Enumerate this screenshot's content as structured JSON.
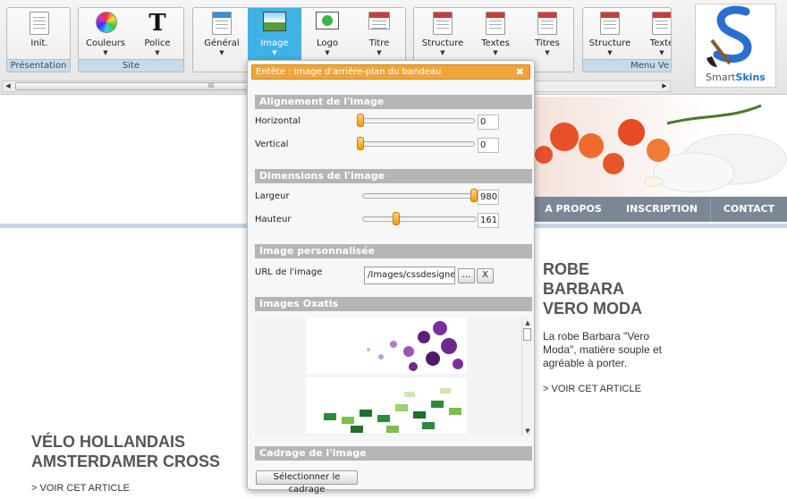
{
  "toolbar": {
    "groups": [
      {
        "title": "Présentation",
        "buttons": [
          {
            "label": "Init."
          }
        ]
      },
      {
        "title": "Site",
        "buttons": [
          {
            "label": "Couleurs"
          },
          {
            "label": "Police"
          }
        ]
      },
      {
        "title": "",
        "buttons": [
          {
            "label": "Général"
          },
          {
            "label": "Image"
          },
          {
            "label": "Logo"
          },
          {
            "label": "Titre"
          }
        ]
      },
      {
        "title": "",
        "buttons": [
          {
            "label": "Structure"
          },
          {
            "label": "Textes"
          },
          {
            "label": "Titres"
          }
        ]
      },
      {
        "title": "Menu Ve",
        "buttons": [
          {
            "label": "Structure"
          },
          {
            "label": "Texte"
          }
        ]
      }
    ],
    "scroll_thumb_grip": "III",
    "active_button": "Image"
  },
  "logo": {
    "word_plain": "Smart",
    "word_bold": "Skins"
  },
  "site": {
    "nav": [
      "A PROPOS",
      "INSCRIPTION",
      "CONTACT"
    ],
    "article1": {
      "title_lines": [
        "ROBE",
        "BARBARA",
        "VERO MODA"
      ],
      "text_lines": [
        "La robe Barbara \"Vero",
        "Moda\", matière souple et",
        "agréable à porter."
      ],
      "link": "> VOIR CET ARTICLE"
    },
    "article2": {
      "title_lines": [
        "VÉLO HOLLANDAIS",
        "AMSTERDAMER CROSS"
      ],
      "link": "> VOIR CET ARTICLE"
    }
  },
  "dialog": {
    "title": "Entête : Image d'arrière-plan du bandeau",
    "close": "✖",
    "alignment": {
      "heading": "Alignement de l'image",
      "horizontal_label": "Horizontal",
      "horizontal_value": "0",
      "vertical_label": "Vertical",
      "vertical_value": "0"
    },
    "dimensions": {
      "heading": "Dimensions de l'image",
      "width_label": "Largeur",
      "width_value": "980",
      "height_label": "Hauteur",
      "height_value": "161"
    },
    "custom_image": {
      "heading": "Image personnalisée",
      "url_label": "URL de l'image",
      "url_value": "/Images/cssdesigner",
      "browse_label": "...",
      "clear_label": "X"
    },
    "oxatis": {
      "heading": "Images Oxatis"
    },
    "crop": {
      "heading": "Cadrage de l'image",
      "button_label": "Sélectionner le cadrage"
    }
  },
  "colors": {
    "accent_orange": "#f0a53a",
    "active_blue": "#3fb2e6",
    "section_gray": "#b5b5b5",
    "nav_gray": "#7b8794"
  }
}
